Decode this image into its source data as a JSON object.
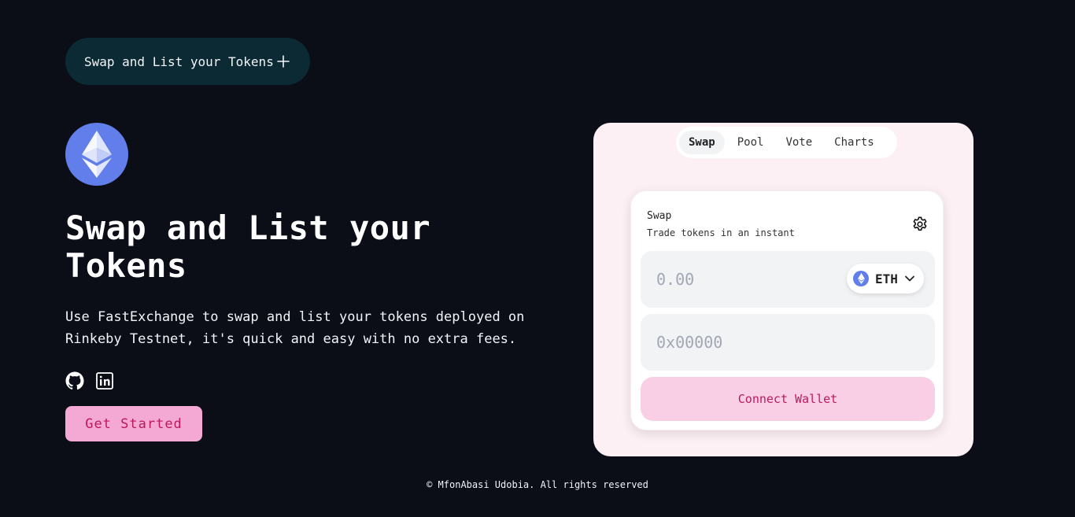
{
  "header": {
    "pill_label": "Swap and List your Tokens"
  },
  "hero": {
    "title": "Swap and List your Tokens",
    "description": "Use FastExchange to swap and list your tokens deployed on Rinkeby Testnet, it's quick and easy with no extra fees.",
    "cta_label": "Get Started",
    "socials": [
      "github-icon",
      "linkedin-icon"
    ]
  },
  "panel": {
    "tabs": [
      {
        "label": "Swap",
        "active": true
      },
      {
        "label": "Pool",
        "active": false
      },
      {
        "label": "Vote",
        "active": false
      },
      {
        "label": "Charts",
        "active": false
      }
    ],
    "card": {
      "title": "Swap",
      "subtitle": "Trade tokens in an instant",
      "amount_placeholder": "0.00",
      "token_symbol": "ETH",
      "address_placeholder": "0x00000",
      "connect_label": "Connect Wallet"
    }
  },
  "footer": {
    "text": "© MfonAbasi Udobia. All rights reserved"
  },
  "colors": {
    "background": "#0b0d17",
    "pill_bg": "#0b2a33",
    "eth_blue": "#627eea",
    "cta_bg": "#f4a8d4",
    "cta_text": "#be185d",
    "panel_bg": "#fdf0f5",
    "connect_bg": "#f9cfe6",
    "bracket": "#e04aa3"
  }
}
